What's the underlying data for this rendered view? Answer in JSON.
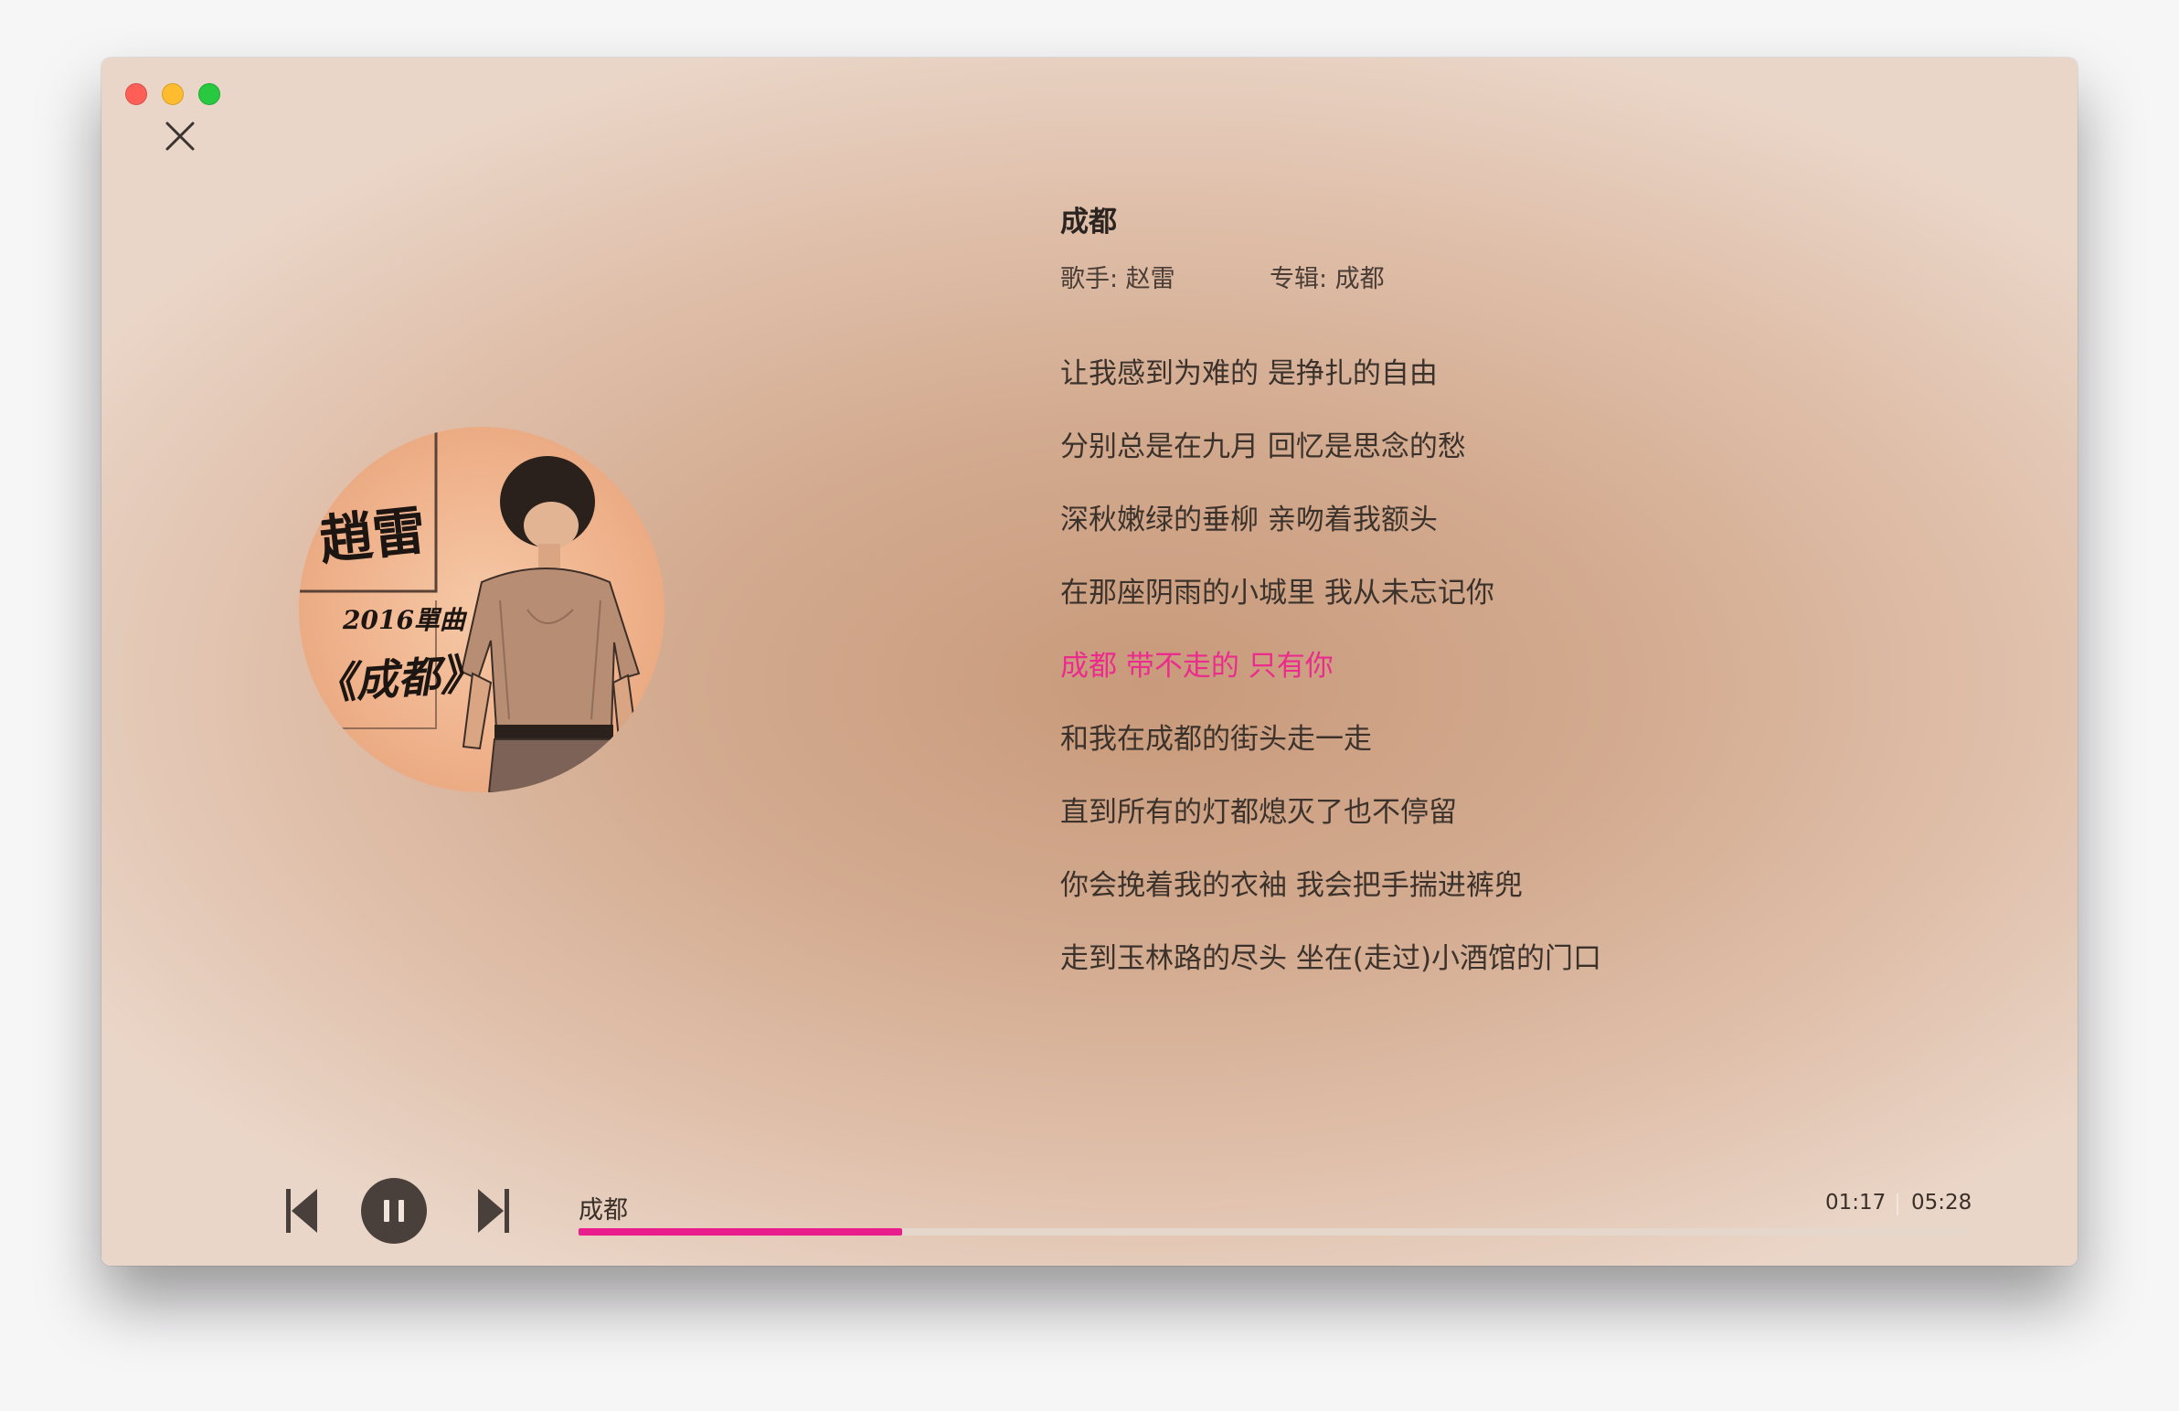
{
  "song": {
    "title": "成都",
    "artist_label": "歌手: 赵雷",
    "album_label": "专辑: 成都"
  },
  "cover": {
    "title_text": "趙雷",
    "subtitle_text": "2016單曲",
    "album_text": "《成都》"
  },
  "lyrics": [
    {
      "text": "让我感到为难的 是挣扎的自由",
      "active": false
    },
    {
      "text": "分别总是在九月 回忆是思念的愁",
      "active": false
    },
    {
      "text": "深秋嫩绿的垂柳 亲吻着我额头",
      "active": false
    },
    {
      "text": "在那座阴雨的小城里 我从未忘记你",
      "active": false
    },
    {
      "text": "成都 带不走的 只有你",
      "active": true
    },
    {
      "text": "和我在成都的街头走一走",
      "active": false
    },
    {
      "text": "直到所有的灯都熄灭了也不停留",
      "active": false
    },
    {
      "text": "你会挽着我的衣袖 我会把手揣进裤兜",
      "active": false
    },
    {
      "text": "走到玉林路的尽头 坐在(走过)小酒馆的门口",
      "active": false
    }
  ],
  "player": {
    "now_playing": "成都",
    "current_time": "01:17",
    "total_time": "05:28",
    "progress": 0.233,
    "state": "playing"
  },
  "colors": {
    "accent": "#ea1d8c",
    "active_lyric": "#ec2c8d",
    "control": "#4a403b"
  },
  "icons": {
    "close": "close-icon",
    "prev": "skip-previous-icon",
    "pause": "pause-icon",
    "next": "skip-next-icon"
  }
}
